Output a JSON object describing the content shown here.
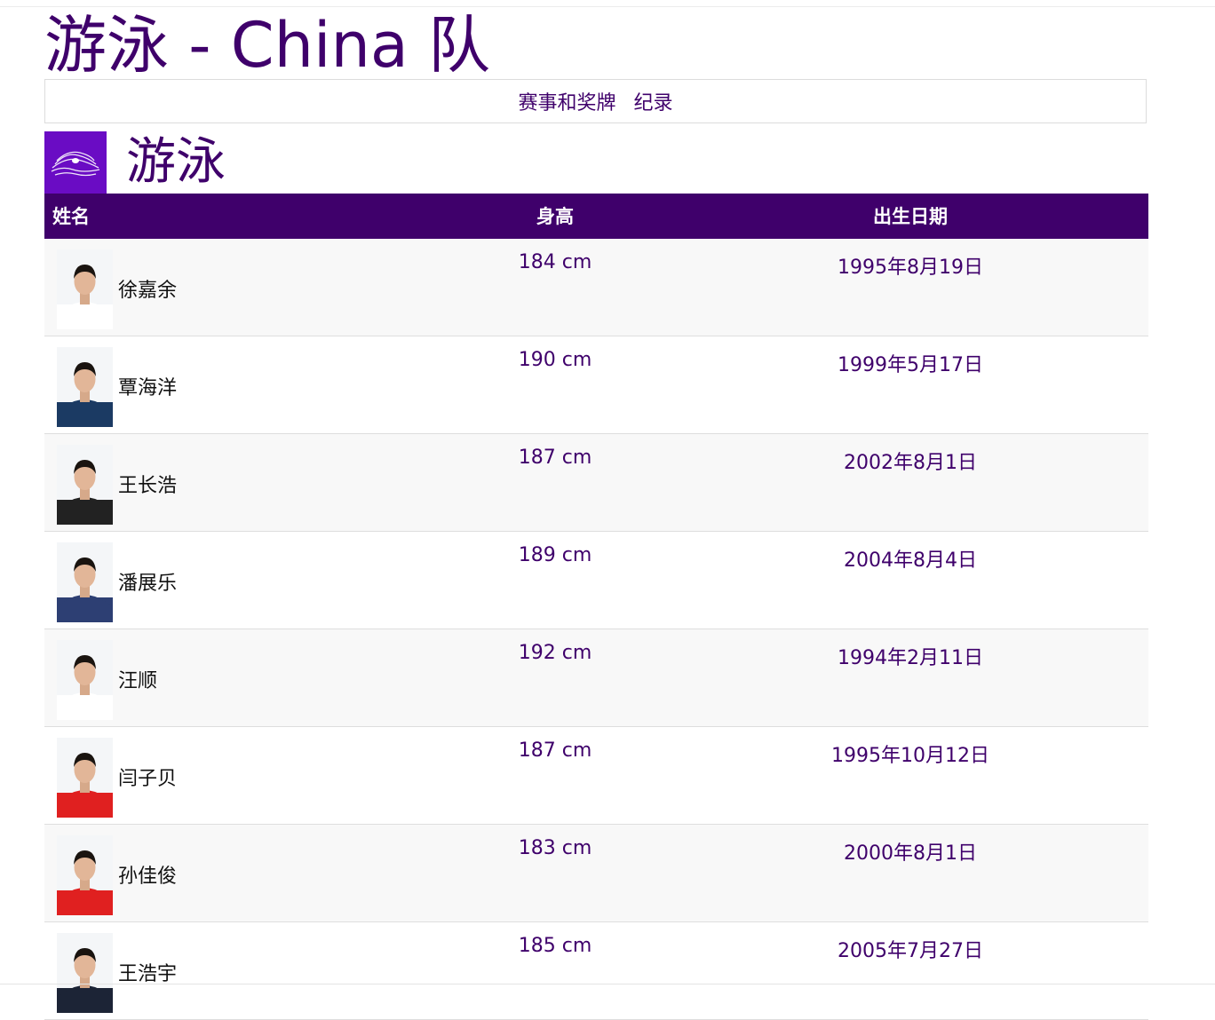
{
  "header": {
    "title": "游泳 - China 队"
  },
  "nav": {
    "events_label": "赛事和奖牌",
    "records_label": "纪录"
  },
  "sport": {
    "name": "游泳",
    "icon": "swimming-pictogram-icon"
  },
  "table": {
    "columns": {
      "name": "姓名",
      "height": "身高",
      "birthdate": "出生日期"
    },
    "rows": [
      {
        "name": "徐嘉余",
        "height": "184 cm",
        "birthdate": "1995年8月19日",
        "shirt": "#ffffff"
      },
      {
        "name": "覃海洋",
        "height": "190 cm",
        "birthdate": "1999年5月17日",
        "shirt": "#1b3a63"
      },
      {
        "name": "王长浩",
        "height": "187 cm",
        "birthdate": "2002年8月1日",
        "shirt": "#222222"
      },
      {
        "name": "潘展乐",
        "height": "189 cm",
        "birthdate": "2004年8月4日",
        "shirt": "#2d3f73"
      },
      {
        "name": "汪顺",
        "height": "192 cm",
        "birthdate": "1994年2月11日",
        "shirt": "#ffffff"
      },
      {
        "name": "闫子贝",
        "height": "187 cm",
        "birthdate": "1995年10月12日",
        "shirt": "#e02020"
      },
      {
        "name": "孙佳俊",
        "height": "183 cm",
        "birthdate": "2000年8月1日",
        "shirt": "#e02020"
      },
      {
        "name": "王浩宇",
        "height": "185 cm",
        "birthdate": "2005年7月27日",
        "shirt": "#1c2436"
      }
    ]
  },
  "colors": {
    "accent": "#3f006b",
    "sport_icon_bg": "#6a0cc4"
  }
}
